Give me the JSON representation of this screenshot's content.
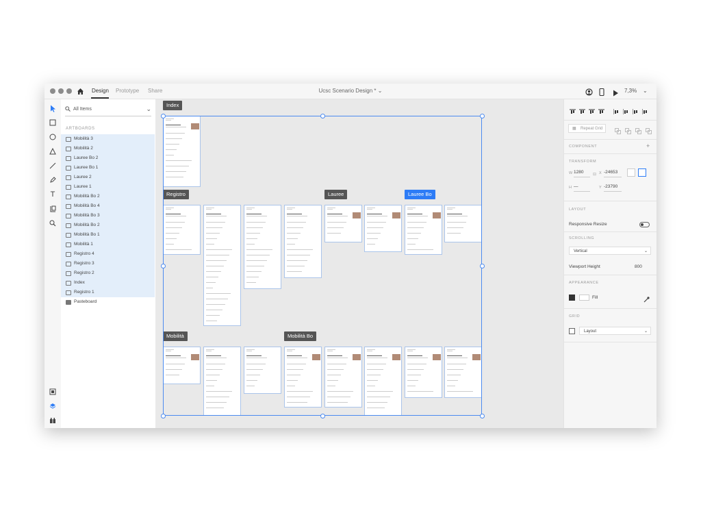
{
  "titlebar": {
    "tabs": [
      "Design",
      "Prototype",
      "Share"
    ],
    "doc_title": "Ucsc Scenario Design *",
    "zoom": "7,3%"
  },
  "layers_panel": {
    "search_label": "All Items",
    "section_label": "ARTBOARDS",
    "items": [
      "Mobilità 3",
      "Mobilità 2",
      "Lauree Bo 2",
      "Lauree Bo 1",
      "Lauree 2",
      "Lauree 1",
      "Mobilità Bo 2",
      "Mobilità Bo 4",
      "Mobilità Bo 3",
      "Mobilità Bo 2",
      "Mobilità Bo 1",
      "Mobilità 1",
      "Registro 4",
      "Registro 3",
      "Registro 2",
      "Index",
      "Registro 1",
      "Pasteboard"
    ]
  },
  "canvas": {
    "labels": {
      "index": "Index",
      "registro": "Registro",
      "lauree": "Lauree",
      "lauree_bo": "Lauree Bo",
      "mobilita": "Mobilità",
      "mobilita_bo": "Mobilità Bo"
    }
  },
  "properties": {
    "repeat_grid": "Repeat Grid",
    "component": "COMPONENT",
    "transform": "TRANSFORM",
    "w_label": "W",
    "w_value": "1280",
    "x_label": "X",
    "x_value": "-24653",
    "h_label": "H",
    "h_value": "—",
    "y_label": "Y",
    "y_value": "-23790",
    "layout": "LAYOUT",
    "responsive_resize": "Responsive Resize",
    "scrolling": "SCROLLING",
    "scrolling_value": "Vertical",
    "viewport_height": "Viewport Height",
    "viewport_value": "800",
    "appearance": "APPEARANCE",
    "fill": "Fill",
    "grid": "GRID",
    "grid_value": "Layout"
  },
  "colors": {
    "accent": "#2d7cf6",
    "selection": "#4b8af0",
    "label_bg": "#555555"
  }
}
